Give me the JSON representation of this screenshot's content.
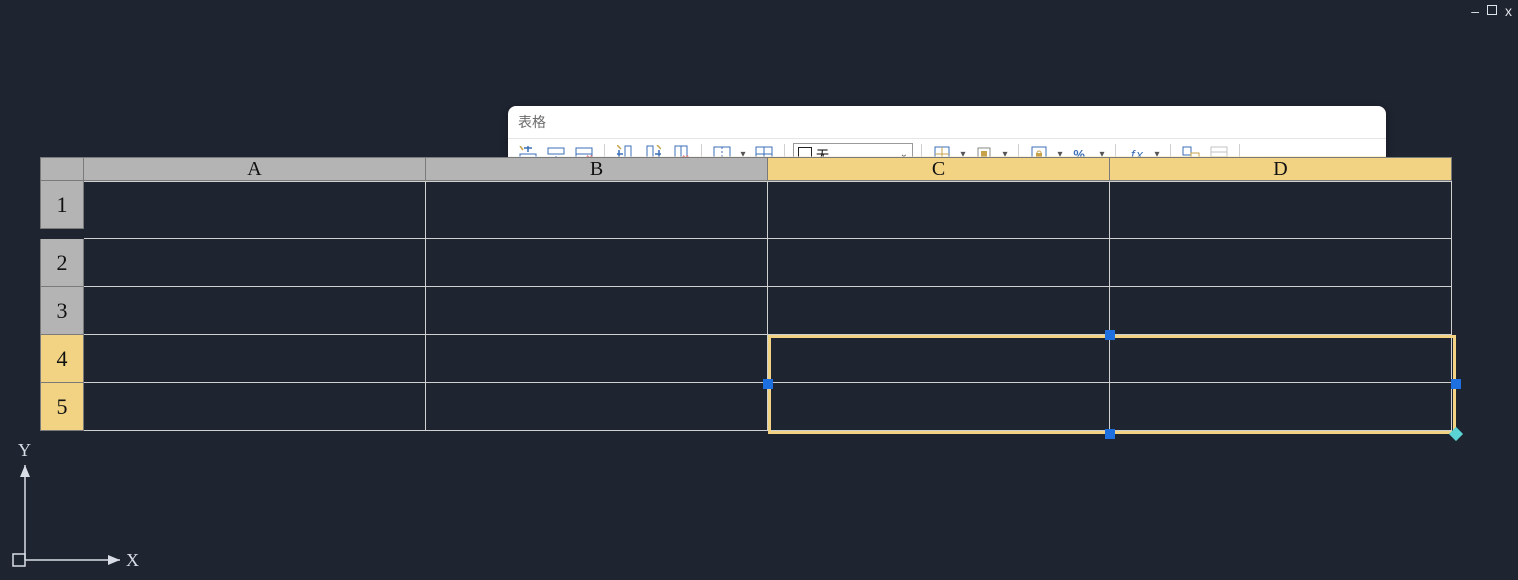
{
  "window": {
    "min": "–",
    "close": "x"
  },
  "toolbar": {
    "title": "表格",
    "layer_select": {
      "value": "无"
    },
    "fx_label": "ƒx",
    "percent_label": "%."
  },
  "table": {
    "columns": [
      "A",
      "B",
      "C",
      "D"
    ],
    "rows": [
      "1",
      "2",
      "3",
      "4",
      "5"
    ],
    "selected_columns": [
      "C",
      "D"
    ],
    "selected_rows": [
      "4",
      "5"
    ]
  },
  "ucs": {
    "x": "X",
    "y": "Y"
  }
}
